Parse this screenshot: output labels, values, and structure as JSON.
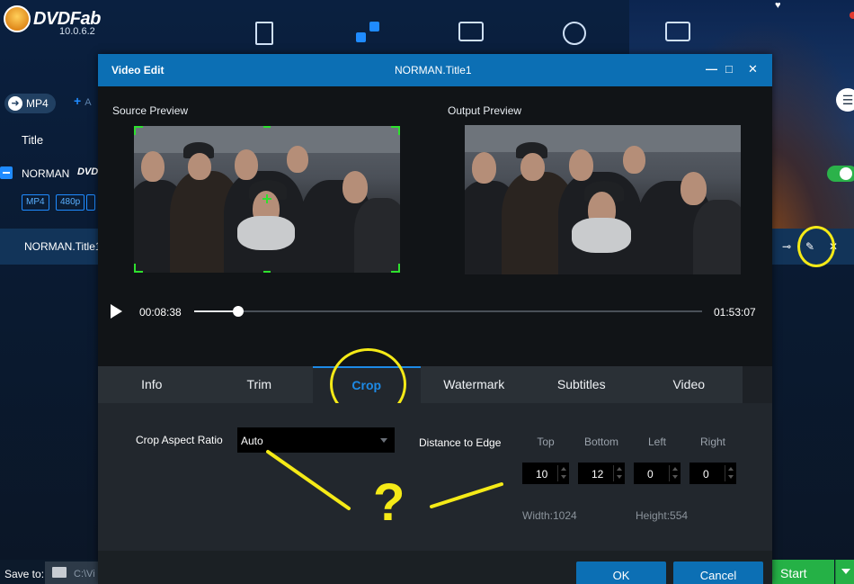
{
  "app": {
    "brand": "DVDFab",
    "version": "10.0.6.2",
    "profile_label": "MP4",
    "add_label": "+",
    "add_hint": "A",
    "title_column": "Title",
    "title_name": "NORMAN",
    "disc_badge": "DVD",
    "chips": [
      "MP4",
      "480p",
      ""
    ],
    "selected_title": "NORMAN.Title1",
    "save_to_label": "Save to:",
    "save_path": "C:\\Vi",
    "start_label": "Start",
    "nav_icons": [
      "copy-icon",
      "convert-icon",
      "video-icon",
      "disc-icon",
      "toolbox-icon"
    ]
  },
  "dialog": {
    "title": "Video Edit",
    "subtitle": "NORMAN.Title1",
    "source_label": "Source Preview",
    "output_label": "Output Preview",
    "current_time": "00:08:38",
    "total_time": "01:53:07",
    "progress": 0.087,
    "tabs": [
      "Info",
      "Trim",
      "Crop",
      "Watermark",
      "Subtitles",
      "Video"
    ],
    "active_tab": "Crop",
    "crop": {
      "aspect_label": "Crop Aspect Ratio",
      "aspect_value": "Auto",
      "distance_label": "Distance to Edge",
      "edges": [
        {
          "label": "Top",
          "value": "10"
        },
        {
          "label": "Bottom",
          "value": "12"
        },
        {
          "label": "Left",
          "value": "0"
        },
        {
          "label": "Right",
          "value": "0"
        }
      ],
      "width_readout": "Width:1024",
      "height_readout": "Height:554"
    },
    "ok_label": "OK",
    "cancel_label": "Cancel"
  },
  "annotation": {
    "question": "?",
    "color": "#f5ea17"
  },
  "colors": {
    "accent": "#0c6fb4",
    "start_green": "#25b146",
    "crop_frame": "#2ee02e",
    "active_tab": "#1d8ae6"
  }
}
